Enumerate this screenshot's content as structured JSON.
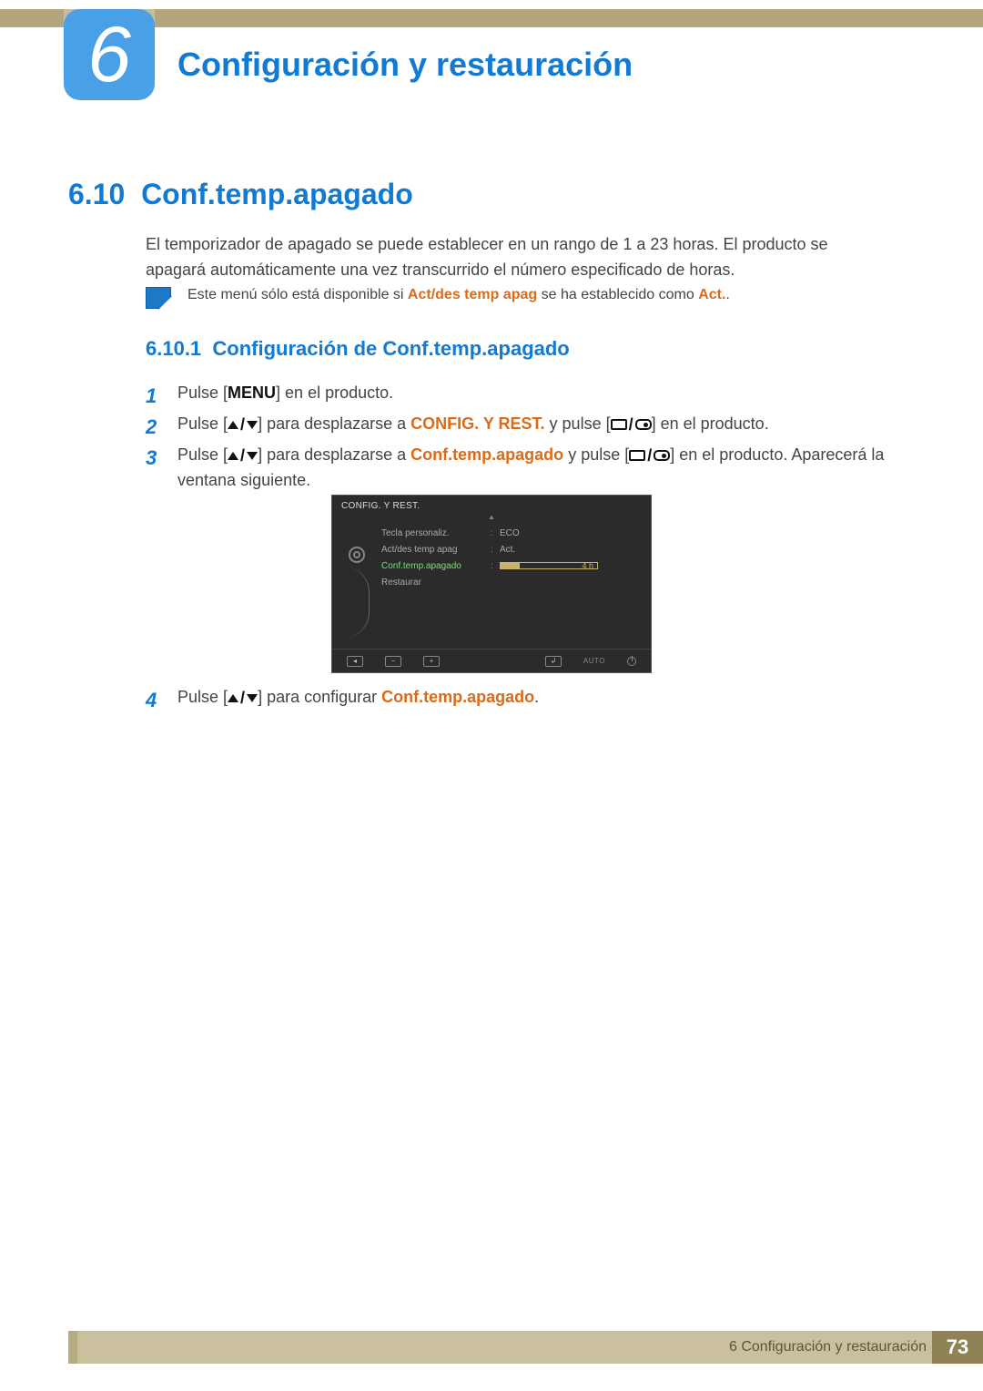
{
  "chapter": {
    "number": "6",
    "title": "Configuración y restauración"
  },
  "section": {
    "number": "6.10",
    "title": "Conf.temp.apagado"
  },
  "intro": "El temporizador de apagado se puede establecer en un rango de 1 a 23 horas. El producto se apagará automáticamente una vez transcurrido el número especificado de horas.",
  "note": {
    "pre": "Este menú sólo está disponible si ",
    "bold1": "Act/des temp apag",
    "mid": " se ha establecido como ",
    "bold2": "Act.",
    "post": "."
  },
  "subsection": {
    "number": "6.10.1",
    "title": "Configuración de Conf.temp.apagado"
  },
  "steps": {
    "s1": {
      "num": "1",
      "a": "Pulse [",
      "menu": "MENU",
      "b": "] en el producto."
    },
    "s2": {
      "num": "2",
      "a": "Pulse [",
      "b": "] para desplazarse a ",
      "target": "CONFIG. Y REST.",
      "c": " y pulse [",
      "d": "] en el producto."
    },
    "s3": {
      "num": "3",
      "a": "Pulse [",
      "b": "] para desplazarse a ",
      "target": "Conf.temp.apagado",
      "c": " y pulse [",
      "d": "] en el producto. Aparecerá la ventana siguiente."
    },
    "s4": {
      "num": "4",
      "a": "Pulse [",
      "b": "] para configurar ",
      "target": "Conf.temp.apagado",
      "c": "."
    }
  },
  "osd": {
    "title": "CONFIG. Y REST.",
    "rows": [
      {
        "label": "Tecla personaliz.",
        "value": "ECO"
      },
      {
        "label": "Act/des temp apag",
        "value": "Act."
      },
      {
        "label": "Conf.temp.apagado",
        "slider_value": "4 h",
        "selected": true
      },
      {
        "label": "Restaurar",
        "value": ""
      }
    ],
    "bottom": {
      "auto": "AUTO"
    }
  },
  "footer": {
    "label": "6 Configuración y restauración",
    "page": "73"
  }
}
